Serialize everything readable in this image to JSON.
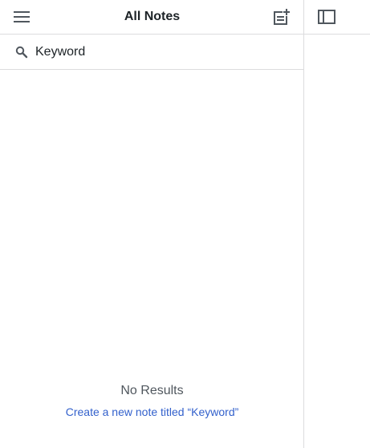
{
  "header": {
    "title": "All Notes",
    "menu_icon": "menu-icon",
    "new_note_icon": "new-note-icon"
  },
  "search": {
    "icon": "search-icon",
    "value": "Keyword"
  },
  "empty_state": {
    "message": "No Results",
    "create_link": "Create a new note titled “Keyword”"
  },
  "right_pane": {
    "toggle_icon": "sidebar-toggle-icon"
  },
  "colors": {
    "text": "#1d2327",
    "muted": "#50575e",
    "link": "#3361cc",
    "icon": "#50575e",
    "border": "#dcdcde"
  }
}
